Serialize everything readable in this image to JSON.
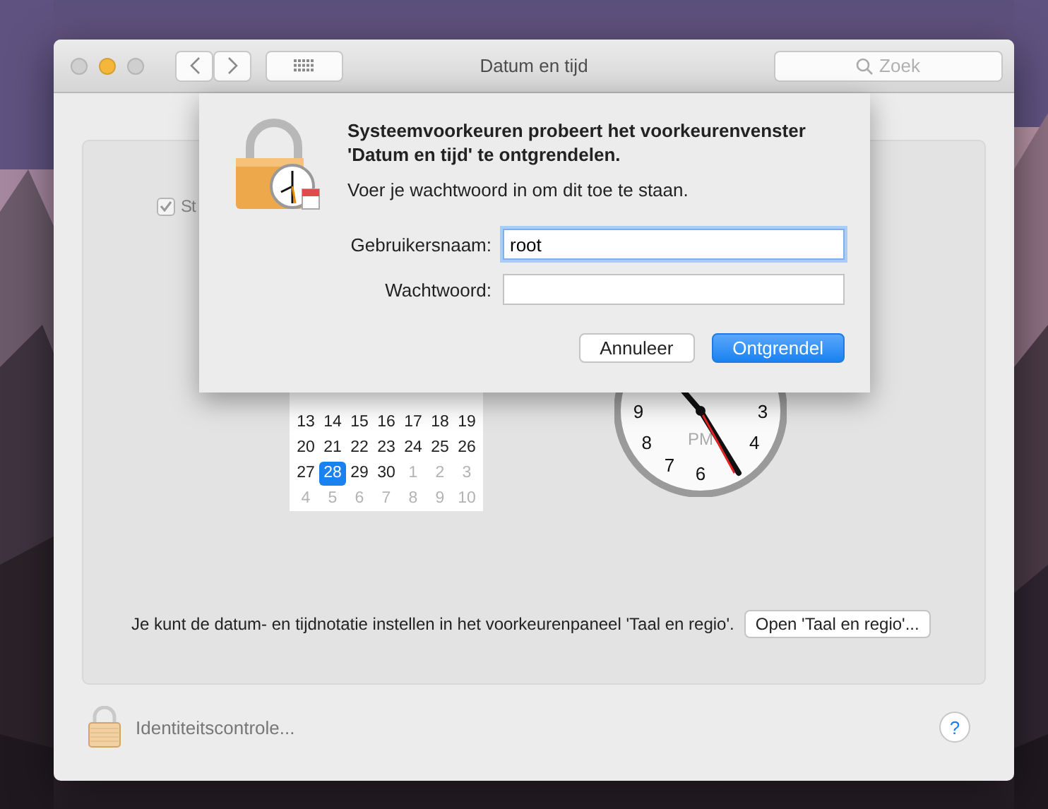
{
  "window": {
    "title": "Datum en tijd",
    "lights": [
      {
        "color": "#cfcfcf"
      },
      {
        "color": "#f5b73b"
      },
      {
        "color": "#cfcfcf"
      }
    ],
    "search": {
      "placeholder": "Zoek"
    }
  },
  "panel": {
    "checkbox": {
      "label": "St",
      "checked": true
    },
    "calendar": {
      "rows": [
        [
          {
            "label": "13",
            "other_month": false,
            "selected": false
          },
          {
            "label": "14",
            "other_month": false,
            "selected": false
          },
          {
            "label": "15",
            "other_month": false,
            "selected": false
          },
          {
            "label": "16",
            "other_month": false,
            "selected": false
          },
          {
            "label": "17",
            "other_month": false,
            "selected": false
          },
          {
            "label": "18",
            "other_month": false,
            "selected": false
          },
          {
            "label": "19",
            "other_month": false,
            "selected": false
          }
        ],
        [
          {
            "label": "20",
            "other_month": false,
            "selected": false
          },
          {
            "label": "21",
            "other_month": false,
            "selected": false
          },
          {
            "label": "22",
            "other_month": false,
            "selected": false
          },
          {
            "label": "23",
            "other_month": false,
            "selected": false
          },
          {
            "label": "24",
            "other_month": false,
            "selected": false
          },
          {
            "label": "25",
            "other_month": false,
            "selected": false
          },
          {
            "label": "26",
            "other_month": false,
            "selected": false
          }
        ],
        [
          {
            "label": "27",
            "other_month": false,
            "selected": false
          },
          {
            "label": "28",
            "other_month": false,
            "selected": true
          },
          {
            "label": "29",
            "other_month": false,
            "selected": false
          },
          {
            "label": "30",
            "other_month": false,
            "selected": false
          },
          {
            "label": "1",
            "other_month": true,
            "selected": false
          },
          {
            "label": "2",
            "other_month": true,
            "selected": false
          },
          {
            "label": "3",
            "other_month": true,
            "selected": false
          }
        ],
        [
          {
            "label": "4",
            "other_month": true,
            "selected": false
          },
          {
            "label": "5",
            "other_month": true,
            "selected": false
          },
          {
            "label": "6",
            "other_month": true,
            "selected": false
          },
          {
            "label": "7",
            "other_month": true,
            "selected": false
          },
          {
            "label": "8",
            "other_month": true,
            "selected": false
          },
          {
            "label": "9",
            "other_month": true,
            "selected": false
          },
          {
            "label": "10",
            "other_month": true,
            "selected": false
          }
        ]
      ]
    },
    "clock": {
      "numbers": [
        "9",
        "3",
        "8",
        "4",
        "7",
        "6"
      ],
      "period": "PM"
    },
    "note": "Je kunt de datum- en tijdnotatie instellen in het voorkeurenpaneel 'Taal en regio'.",
    "open_button": "Open 'Taal en regio'..."
  },
  "footer": {
    "lock_label": "Identiteitscontrole...",
    "help": "?"
  },
  "sheet": {
    "title": "Systeemvoorkeuren probeert het voorkeurenvenster 'Datum en tijd' te ontgrendelen.",
    "message": "Voer je wachtwoord in om dit toe te staan.",
    "fields": [
      {
        "label": "Gebruikersnaam:",
        "value": "root",
        "focused": true
      },
      {
        "label": "Wachtwoord:",
        "focused": false
      }
    ],
    "buttons": [
      {
        "label": "Annuleer",
        "default": false
      },
      {
        "label": "Ontgrendel",
        "default": true
      }
    ]
  }
}
